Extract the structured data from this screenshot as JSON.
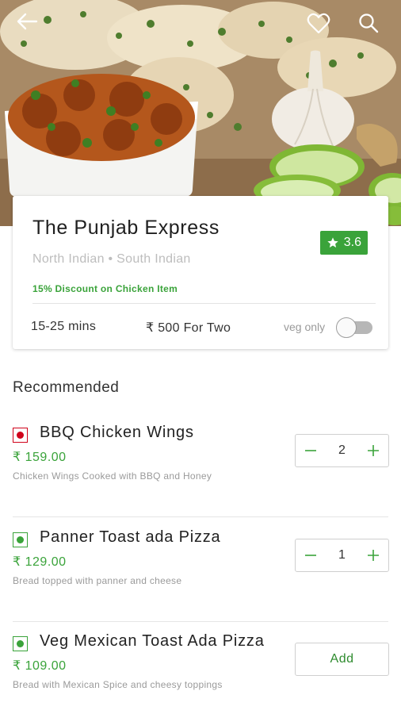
{
  "restaurant": {
    "name": "The Punjab Express",
    "cuisines": "North Indian • South Indian",
    "rating": "3.6",
    "discount": "15% Discount on Chicken Item",
    "delivery_time": "15-25 mins",
    "price_for_two": "₹ 500 For Two",
    "veg_only_label": "veg only",
    "veg_only_enabled": false
  },
  "menu": {
    "section_title": "Recommended",
    "items": [
      {
        "name": "BBQ Chicken Wings",
        "price": "₹ 159.00",
        "description": "Chicken Wings Cooked with BBQ and Honey",
        "type": "non-veg",
        "quantity": "2"
      },
      {
        "name": "Panner Toast ada Pizza",
        "price": "₹ 129.00",
        "description": "Bread topped with panner and cheese",
        "type": "veg",
        "quantity": "1"
      },
      {
        "name": "Veg Mexican Toast Ada Pizza",
        "price": "₹ 109.00",
        "description": "Bread with Mexican Spice and cheesy toppings",
        "type": "veg",
        "add_label": "Add"
      }
    ]
  },
  "icons": {
    "back": "arrow-left-icon",
    "favorite": "heart-outline-icon",
    "search": "search-icon",
    "rating": "star-icon",
    "decrement": "minus-icon",
    "increment": "plus-icon"
  },
  "colors": {
    "accent_green": "#3aa33a",
    "nonveg_red": "#d0021b",
    "veg_green": "#3aa33a"
  }
}
